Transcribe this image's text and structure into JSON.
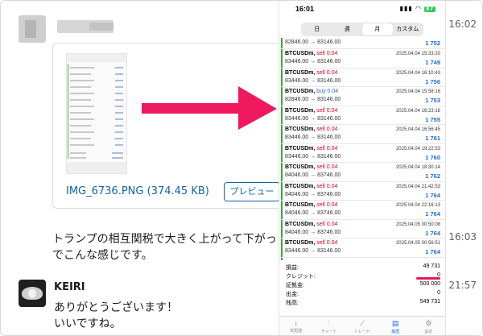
{
  "chat": {
    "attachment": {
      "filename": "IMG_6736.PNG (374.45 KB)",
      "preview_label": "プレビュー"
    },
    "message": {
      "line1": "トランプの相互関税で大きく上がって下がっ",
      "line2": "でこんな感じです。"
    },
    "reply": {
      "author": "KEIRI",
      "line1": "ありがとうございます！",
      "line2": "いいですね。"
    },
    "timestamps": [
      "16:02",
      "16:03",
      "21:57"
    ]
  },
  "phone": {
    "status_time": "16:01",
    "battery": "87",
    "period_tabs": [
      {
        "label": "日",
        "active": false
      },
      {
        "label": "週",
        "active": false
      },
      {
        "label": "月",
        "active": true
      },
      {
        "label": "カスタム",
        "active": false
      }
    ],
    "first_row": {
      "prices": "82846.00 → 83146.00",
      "profit": "1 752"
    },
    "trades": [
      {
        "symbol": "BTCUSDm,",
        "type": "sell 0.04",
        "side": "sell",
        "date": "2025.04.04 15:33:20",
        "prices": "83446.00 → 83146.00",
        "profit": "1 749"
      },
      {
        "symbol": "BTCUSDm,",
        "type": "sell 0.04",
        "side": "sell",
        "date": "2025.04.04 16:10:43",
        "prices": "83446.00 → 83146.00",
        "profit": "1 756"
      },
      {
        "symbol": "BTCUSDm,",
        "type": "buy 0.04",
        "side": "buy",
        "date": "2025.04.04 15:58:16",
        "prices": "82846.00 → 83146.00",
        "profit": "1 753"
      },
      {
        "symbol": "BTCUSDm,",
        "type": "sell 0.04",
        "side": "sell",
        "date": "2025.04.04 16:23:16",
        "prices": "83446.00 → 83146.00",
        "profit": "1 755"
      },
      {
        "symbol": "BTCUSDm,",
        "type": "sell 0.04",
        "side": "sell",
        "date": "2025.04.04 16:56:45",
        "prices": "83446.00 → 83146.00",
        "profit": "1 761"
      },
      {
        "symbol": "BTCUSDm,",
        "type": "sell 0.04",
        "side": "sell",
        "date": "2025.04.04 19:22:53",
        "prices": "83446.00 → 83146.00",
        "profit": "1 760"
      },
      {
        "symbol": "BTCUSDm,",
        "type": "sell 0.04",
        "side": "sell",
        "date": "2025.04.04 18:30:14",
        "prices": "84046.00 → 83746.00",
        "profit": "1 762"
      },
      {
        "symbol": "BTCUSDm,",
        "type": "sell 0.04",
        "side": "sell",
        "date": "2025.04.04 21:42:53",
        "prices": "84046.00 → 83746.00",
        "profit": "1 764"
      },
      {
        "symbol": "BTCUSDm,",
        "type": "sell 0.04",
        "side": "sell",
        "date": "2025.04.04 22:16:13",
        "prices": "84046.00 → 83746.00",
        "profit": "1 764"
      },
      {
        "symbol": "BTCUSDm,",
        "type": "sell 0.04",
        "side": "sell",
        "date": "2025.04.05 00:50:08",
        "prices": "84046.00 → 83746.00",
        "profit": "1 764"
      },
      {
        "symbol": "BTCUSDm,",
        "type": "sell 0.04",
        "side": "sell",
        "date": "2025.04.05 00:56:51",
        "prices": "83446.00 → 83146.00",
        "profit": "1 764"
      }
    ],
    "summary": [
      {
        "label": "損益:",
        "value": "49 731"
      },
      {
        "label": "クレジット:",
        "value": "0"
      },
      {
        "label": "証拠金:",
        "value": "500 000"
      },
      {
        "label": "出金:",
        "value": "0"
      },
      {
        "label": "残高:",
        "value": "549 731"
      }
    ],
    "tabs": [
      {
        "label": "気配値",
        "icon": "↕"
      },
      {
        "label": "チャート",
        "icon": "⫶"
      },
      {
        "label": "トレード",
        "icon": "⟋"
      },
      {
        "label": "履歴",
        "icon": "▤",
        "active": true
      },
      {
        "label": "設定",
        "icon": "⚙"
      }
    ]
  }
}
